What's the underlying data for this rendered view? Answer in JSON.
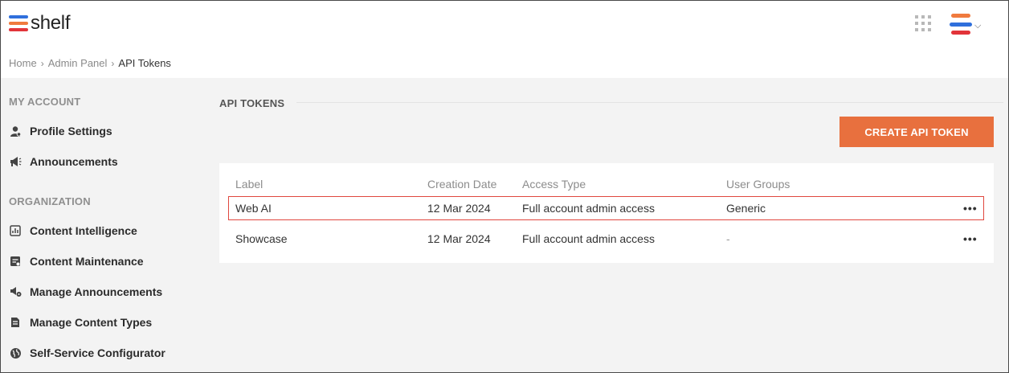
{
  "app": {
    "logo_text": "shelf"
  },
  "breadcrumb": {
    "home": "Home",
    "admin": "Admin Panel",
    "current": "API Tokens",
    "separator": "›"
  },
  "sidebar": {
    "my_account_heading": "MY ACCOUNT",
    "organization_heading": "ORGANIZATION",
    "items": [
      {
        "label": "Profile Settings",
        "icon": "profile-settings-icon"
      },
      {
        "label": "Announcements",
        "icon": "megaphone-icon"
      },
      {
        "label": "Content Intelligence",
        "icon": "content-intelligence-icon"
      },
      {
        "label": "Content Maintenance",
        "icon": "content-maintenance-icon"
      },
      {
        "label": "Manage Announcements",
        "icon": "manage-announcements-icon"
      },
      {
        "label": "Manage Content Types",
        "icon": "document-icon"
      },
      {
        "label": "Self-Service Configurator",
        "icon": "globe-icon"
      }
    ]
  },
  "main": {
    "title": "API TOKENS",
    "create_button": "CREATE API TOKEN",
    "columns": [
      "Label",
      "Creation Date",
      "Access Type",
      "User Groups"
    ],
    "rows": [
      {
        "label": "Web AI",
        "date": "12 Mar 2024",
        "access": "Full account admin access",
        "groups": "Generic",
        "highlighted": true
      },
      {
        "label": "Showcase",
        "date": "12 Mar 2024",
        "access": "Full account admin access",
        "groups": "-",
        "highlighted": false
      }
    ],
    "row_menu_glyph": "•••"
  },
  "colors": {
    "accent": "#e8703e",
    "highlight_border": "#e0473f",
    "logo_blue": "#2f6fdc",
    "logo_orange": "#f07a3e",
    "logo_red": "#e2343a"
  }
}
